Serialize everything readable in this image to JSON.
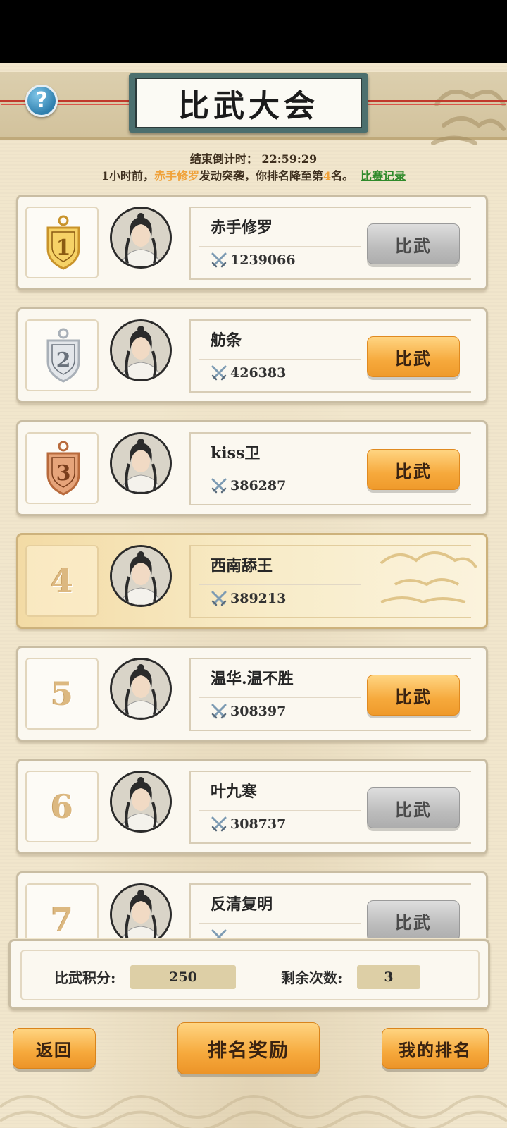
{
  "header": {
    "title": "比武大会",
    "help_label": "?",
    "countdown": "结束倒计时：  22:59:29",
    "notice_prefix": "1小时前，",
    "notice_attacker": "赤手修罗",
    "notice_mid": "发动突袭，你排名降至第",
    "notice_rank": "4",
    "notice_suffix": "名。",
    "record_link": "比赛记录"
  },
  "ranking": [
    {
      "rank": "1",
      "name": "赤手修罗",
      "power": "1239066",
      "button": "比武",
      "button_state": "disabled",
      "medal": "gold"
    },
    {
      "rank": "2",
      "name": "舫条",
      "power": "426383",
      "button": "比武",
      "button_state": "active",
      "medal": "silver"
    },
    {
      "rank": "3",
      "name": "kiss卫",
      "power": "386287",
      "button": "比武",
      "button_state": "active",
      "medal": "bronze"
    },
    {
      "rank": "4",
      "name": "西南舔王",
      "power": "389213",
      "button": "",
      "button_state": "self",
      "medal": "none"
    },
    {
      "rank": "5",
      "name": "温华.温不胜",
      "power": "308397",
      "button": "比武",
      "button_state": "active",
      "medal": "none"
    },
    {
      "rank": "6",
      "name": "叶九寒",
      "power": "308737",
      "button": "比武",
      "button_state": "disabled",
      "medal": "none"
    },
    {
      "rank": "7",
      "name": "反清复明",
      "power": "",
      "button": "比武",
      "button_state": "disabled",
      "medal": "none"
    }
  ],
  "score_panel": {
    "points_label": "比武积分:",
    "points_value": "250",
    "remaining_label": "剩余次数:",
    "remaining_value": "3"
  },
  "bottom": {
    "back": "返回",
    "rewards": "排名奖励",
    "my_rank": "我的排名"
  },
  "colors": {
    "accent_gold": "#f6a93c",
    "highlight_orange": "#f0a23a",
    "link_green": "#2f8a2a",
    "background_parchment": "#f1e6cc"
  }
}
